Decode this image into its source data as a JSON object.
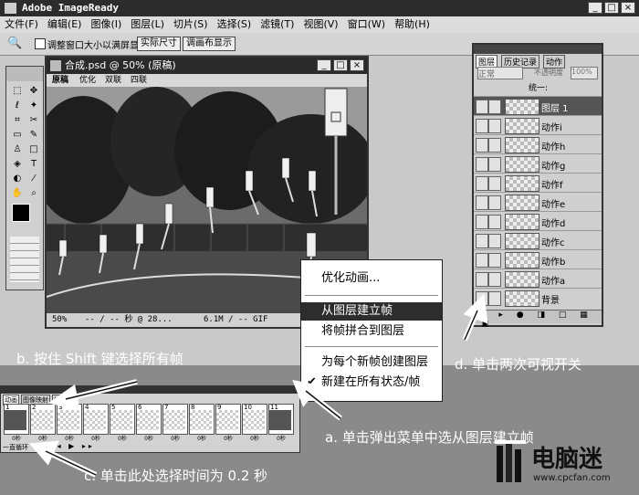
{
  "app": {
    "title": "Adobe ImageReady",
    "win_controls": [
      "_",
      "□",
      "×"
    ]
  },
  "menu": [
    "文件(F)",
    "编辑(E)",
    "图像(I)",
    "图层(L)",
    "切片(S)",
    "选择(S)",
    "滤镜(T)",
    "视图(V)",
    "窗口(W)",
    "帮助(H)"
  ],
  "options": {
    "checkbox_label": "调整窗口大小以满屏显示",
    "btn_actual": "实际尺寸",
    "btn_fit": "调画布显示"
  },
  "doc": {
    "title": "合成.psd @ 50% (原稿)",
    "tabs": [
      "原稿",
      "优化",
      "双联",
      "四联"
    ],
    "status_zoom": "50%",
    "status_time": "-- / -- 秒 @ 28...",
    "status_size": "6.1M / -- GIF"
  },
  "layers": {
    "tabs": [
      "图层",
      "历史记录",
      "动作"
    ],
    "mode": "正常",
    "opacity_label": "不透明度",
    "opacity": "100%",
    "unify_label": "统一:",
    "items": [
      {
        "name": "图层 1",
        "selected": true
      },
      {
        "name": "动作i"
      },
      {
        "name": "动作h"
      },
      {
        "name": "动作g"
      },
      {
        "name": "动作f"
      },
      {
        "name": "动作e"
      },
      {
        "name": "动作d"
      },
      {
        "name": "动作c"
      },
      {
        "name": "动作b"
      },
      {
        "name": "动作a"
      },
      {
        "name": "背景"
      }
    ]
  },
  "context_menu": {
    "items": [
      {
        "label": "优化动画..."
      },
      {
        "label": "从图层建立帧",
        "highlighted": true
      },
      {
        "label": "将帧拼合到图层"
      },
      {
        "label": "为每个新帧创建图层"
      },
      {
        "label": "新建在所有状态/帧",
        "checked": true
      }
    ]
  },
  "animation": {
    "tabs": [
      "动画",
      "图像映射",
      "切片"
    ],
    "loop": "一直循环",
    "frame_numbers": [
      "1",
      "2",
      "3",
      "4",
      "5",
      "6",
      "7",
      "8",
      "9",
      "10",
      "11"
    ],
    "frame_delay": "0秒"
  },
  "captions": {
    "a": "a. 单击弹出菜单中选从图层建立帧",
    "b": "b. 按住 Shift 键选择所有帧",
    "c": "c. 单击此处选择时间为 0.2 秒",
    "d": "d. 单击两次可视开关"
  },
  "watermark": {
    "name": "电脑迷",
    "url": "www.cpcfan.com"
  }
}
